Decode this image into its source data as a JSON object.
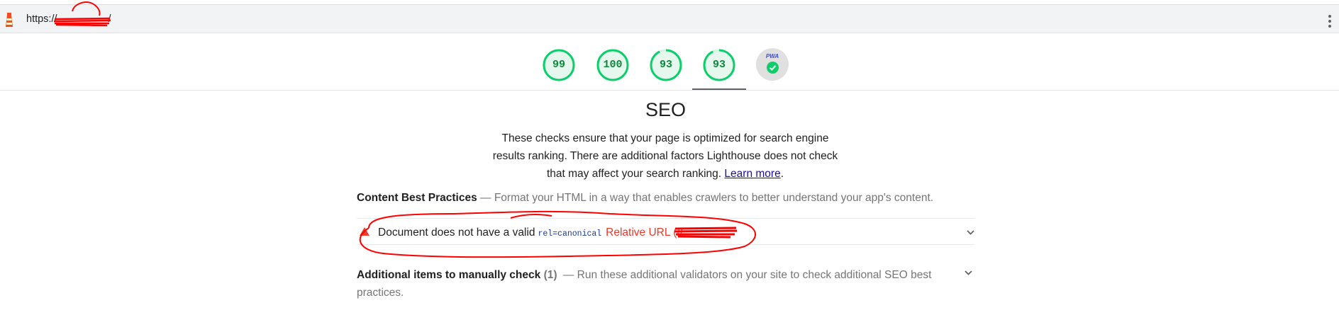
{
  "topbar": {
    "url_prefix": "https://",
    "url_suffix": "/"
  },
  "gauges": [
    {
      "score": "99",
      "fraction": 0.99
    },
    {
      "score": "100",
      "fraction": 1.0
    },
    {
      "score": "93",
      "fraction": 0.93
    },
    {
      "score": "93",
      "fraction": 0.93
    }
  ],
  "pwa": {
    "badge": "PWA"
  },
  "colors": {
    "pass": "#0cce6b",
    "fail": "#eb3e2d",
    "redaction": "#ff0000"
  },
  "category": {
    "title": "SEO",
    "description": "These checks ensure that your page is optimized for search engine results ranking. There are additional factors Lighthouse does not check that may affect your search ranking.",
    "learn_more": "Learn more",
    "period": "."
  },
  "group": {
    "title": "Content Best Practices",
    "dash": "—",
    "description": "Format your HTML in a way that enables crawlers to better understand your app's content."
  },
  "audit": {
    "title": "Document does not have a valid",
    "code": "rel=canonical",
    "error": "Relative URL (//"
  },
  "manual": {
    "title": "Additional items to manually check",
    "count": "(1)",
    "dash": "—",
    "description": "Run these additional validators on your site to check additional SEO best practices."
  }
}
